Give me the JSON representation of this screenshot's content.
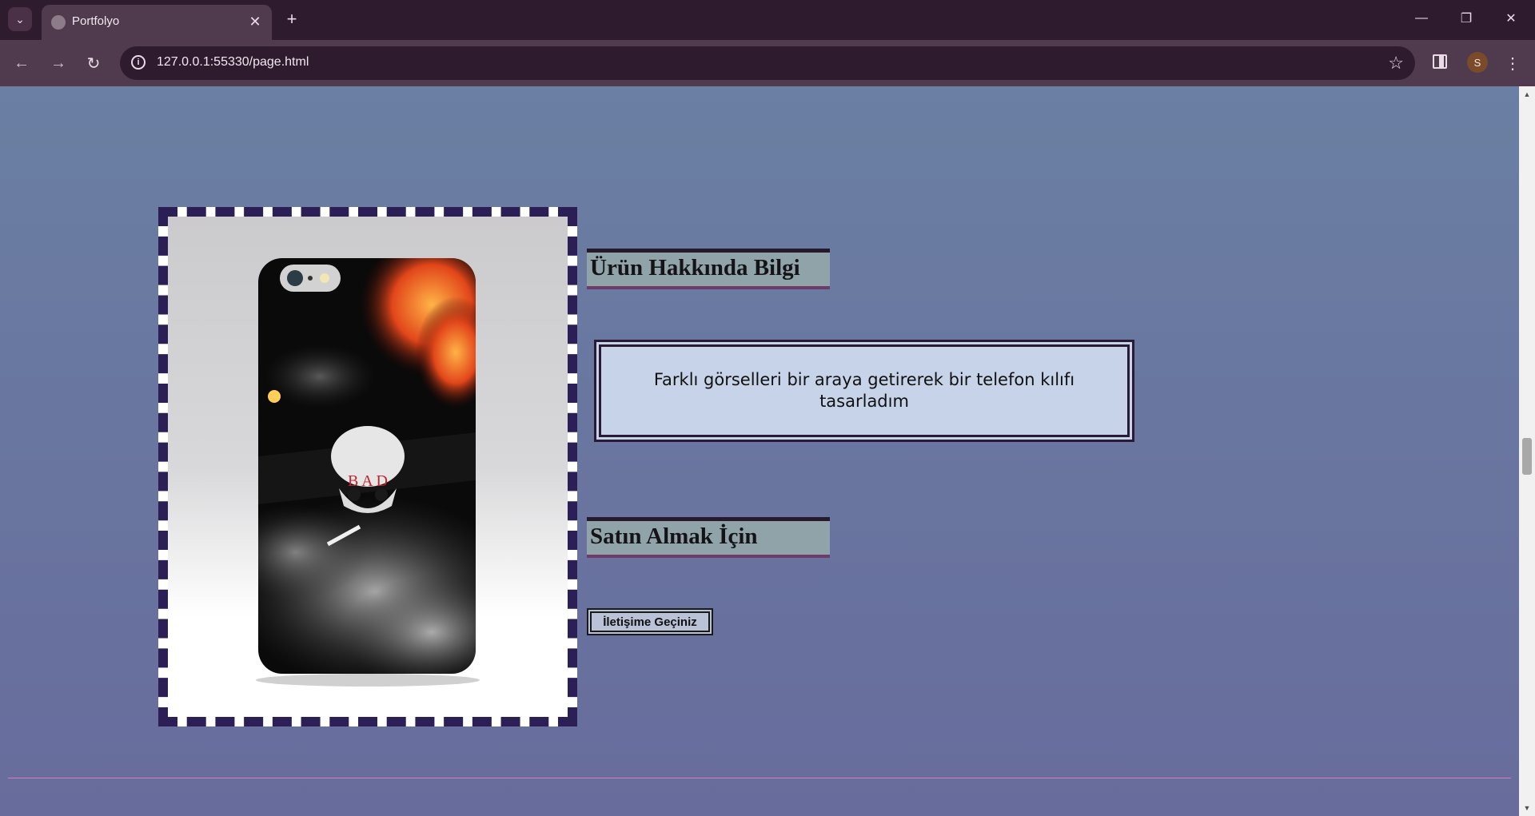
{
  "browser": {
    "tab_title": "Portfolyo",
    "url": "127.0.0.1:55330/page.html",
    "avatar_letter": "S"
  },
  "page": {
    "product_heading": "Ürün Hakkında Bilgi",
    "product_description": "Farklı görselleri bir araya getirerek bir telefon kılıfı tasarladım",
    "purchase_heading": "Satın Almak İçin",
    "contact_button": "İletişime Geçiniz",
    "case_text": "B A D"
  },
  "colors": {
    "tab_strip": "#2f1b2e",
    "toolbar": "#503a4d",
    "page_background": "#6a76a0",
    "frame_border": "#2b1f55",
    "heading_background": "#8fa3a9",
    "info_box_background": "#c6d3e8",
    "divider": "#d07fb8"
  }
}
